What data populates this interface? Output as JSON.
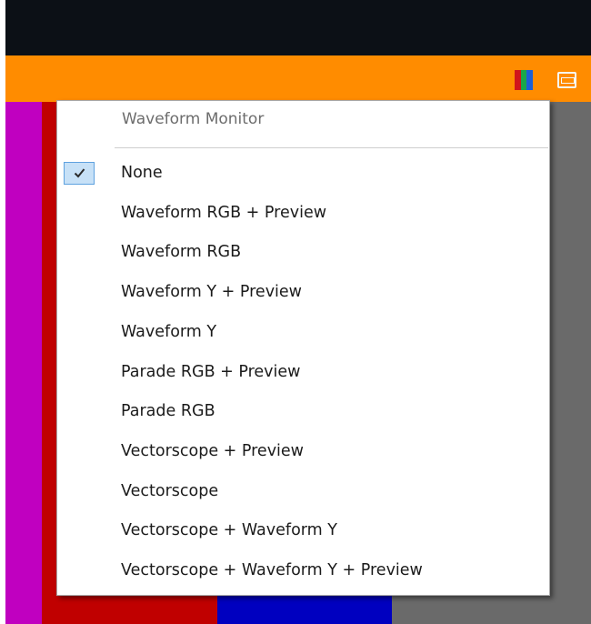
{
  "colors": {
    "top_bar": "#0c1016",
    "toolbar": "#ff8c00",
    "bars": [
      "#c000c0",
      "#c00000",
      "#0000c0",
      "#6a6a6a"
    ],
    "colorbars_icon": [
      "#d0151b",
      "#1aa84a",
      "#1d5fd6"
    ],
    "check_highlight": "#c7e1f7",
    "check_border": "#5fa2df"
  },
  "toolbar": {
    "icons": [
      "color-bars-icon",
      "monitor-icon"
    ]
  },
  "menu": {
    "header": "Waveform Monitor",
    "selected_index": 0,
    "items": [
      {
        "label": "None"
      },
      {
        "label": "Waveform RGB + Preview"
      },
      {
        "label": "Waveform RGB"
      },
      {
        "label": "Waveform Y + Preview"
      },
      {
        "label": "Waveform Y"
      },
      {
        "label": "Parade RGB + Preview"
      },
      {
        "label": "Parade RGB"
      },
      {
        "label": "Vectorscope + Preview"
      },
      {
        "label": "Vectorscope"
      },
      {
        "label": "Vectorscope + Waveform Y"
      },
      {
        "label": "Vectorscope + Waveform Y + Preview"
      }
    ]
  }
}
